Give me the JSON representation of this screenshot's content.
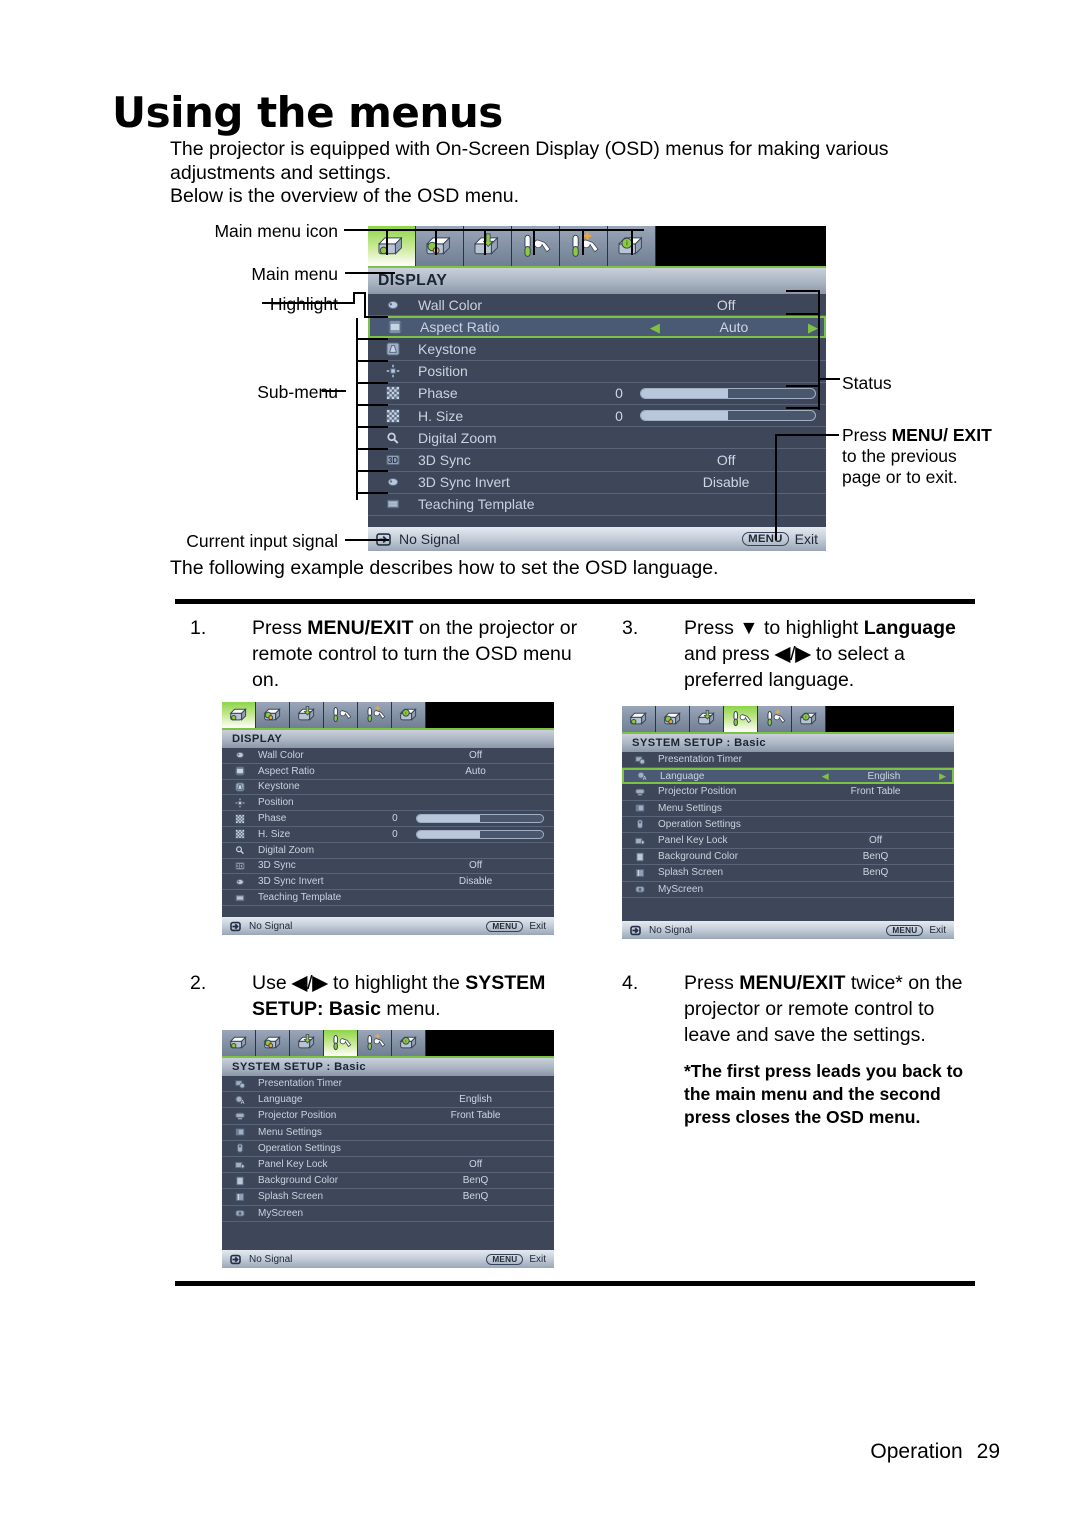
{
  "page": {
    "heading": "Using the menus",
    "intro_p1": "The projector is equipped with On-Screen Display (OSD) menus for making various adjustments and settings.",
    "intro_p2": "Below is the overview of the OSD menu.",
    "example_line": "The following example describes how to set the OSD language.",
    "footer_label": "Operation",
    "footer_page": "29"
  },
  "callouts": {
    "main_menu_icon": "Main menu icon",
    "main_menu": "Main menu",
    "highlight": "Highlight",
    "sub_menu": "Sub-menu",
    "current_input_signal": "Current input signal",
    "status": "Status",
    "press_menu_exit": {
      "pre": "Press ",
      "bold": "MENU/ EXIT",
      "post": " to the previous page or to exit."
    }
  },
  "steps": [
    {
      "num": "1.",
      "parts": [
        {
          "t": "Press ",
          "b": false
        },
        {
          "t": "MENU/EXIT",
          "b": true
        },
        {
          "t": " on the projector or remote control to turn the OSD menu on.",
          "b": false
        }
      ]
    },
    {
      "num": "2.",
      "parts": [
        {
          "t": "Use ",
          "b": false
        },
        {
          "t": "◀",
          "b": true
        },
        {
          "t": "/",
          "b": false
        },
        {
          "t": "▶",
          "b": true
        },
        {
          "t": " to highlight the ",
          "b": false
        },
        {
          "t": "SYSTEM SETUP: Basic",
          "b": true
        },
        {
          "t": " menu.",
          "b": false
        }
      ]
    },
    {
      "num": "3.",
      "parts": [
        {
          "t": "Press ",
          "b": false
        },
        {
          "t": "▼",
          "b": true
        },
        {
          "t": " to highlight ",
          "b": false
        },
        {
          "t": "Language",
          "b": true
        },
        {
          "t": " and press ",
          "b": false
        },
        {
          "t": "◀",
          "b": true
        },
        {
          "t": "/",
          "b": false
        },
        {
          "t": "▶",
          "b": true
        },
        {
          "t": " to select a preferred language.",
          "b": false
        }
      ]
    },
    {
      "num": "4.",
      "parts": [
        {
          "t": "Press ",
          "b": false
        },
        {
          "t": "MENU/EXIT",
          "b": true
        },
        {
          "t": " twice* on the projector or remote control to leave and save the settings.",
          "b": false
        }
      ],
      "note": "*The first press leads you back to the main menu and the second press closes the OSD menu."
    }
  ],
  "osd_colors": {
    "panel_bg": "#3e4759",
    "highlight_green": "#7dc242",
    "row_divider": "#59637a",
    "label_text": "#c9d2e0",
    "title_text": "#1a2433"
  },
  "osd_screens": {
    "display_large": {
      "title": "DISPLAY",
      "selected_tab": 0,
      "tabs": [
        "display-icon",
        "picture-icon",
        "source-icon",
        "system-setup-basic-icon",
        "system-setup-advanced-icon",
        "information-icon"
      ],
      "rows": [
        {
          "icon": "wall-color-icon",
          "label": "Wall Color",
          "value": "Off"
        },
        {
          "icon": "aspect-ratio-icon",
          "label": "Aspect Ratio",
          "value": "Auto",
          "highlight": true,
          "arrows": true
        },
        {
          "icon": "keystone-icon",
          "label": "Keystone",
          "value": ""
        },
        {
          "icon": "position-icon",
          "label": "Position",
          "value": ""
        },
        {
          "icon": "phase-icon",
          "label": "Phase",
          "value": "0",
          "bar": 50
        },
        {
          "icon": "h-size-icon",
          "label": "H. Size",
          "value": "0",
          "bar": 50
        },
        {
          "icon": "digital-zoom-icon",
          "label": "Digital Zoom",
          "value": ""
        },
        {
          "icon": "3d-sync-icon",
          "label": "3D Sync",
          "value": "Off"
        },
        {
          "icon": "3d-sync-invert-icon",
          "label": "3D Sync Invert",
          "value": "Disable"
        },
        {
          "icon": "teaching-template-icon",
          "label": "Teaching Template",
          "value": ""
        }
      ],
      "status_signal": "No Signal",
      "status_key": "MENU",
      "status_action": "Exit"
    },
    "display_small": {
      "title": "DISPLAY",
      "selected_tab": 0,
      "rows": [
        {
          "icon": "wall-color-icon",
          "label": "Wall Color",
          "value": "Off"
        },
        {
          "icon": "aspect-ratio-icon",
          "label": "Aspect Ratio",
          "value": "Auto"
        },
        {
          "icon": "keystone-icon",
          "label": "Keystone",
          "value": ""
        },
        {
          "icon": "position-icon",
          "label": "Position",
          "value": ""
        },
        {
          "icon": "phase-icon",
          "label": "Phase",
          "value": "0",
          "bar": 50
        },
        {
          "icon": "h-size-icon",
          "label": "H. Size",
          "value": "0",
          "bar": 50
        },
        {
          "icon": "digital-zoom-icon",
          "label": "Digital Zoom",
          "value": ""
        },
        {
          "icon": "3d-sync-icon",
          "label": "3D Sync",
          "value": "Off"
        },
        {
          "icon": "3d-sync-invert-icon",
          "label": "3D Sync Invert",
          "value": "Disable"
        },
        {
          "icon": "teaching-template-icon",
          "label": "Teaching Template",
          "value": ""
        }
      ],
      "status_signal": "No Signal",
      "status_key": "MENU",
      "status_action": "Exit"
    },
    "system_setup_plain": {
      "title": "SYSTEM SETUP : Basic",
      "selected_tab": 3,
      "rows": [
        {
          "icon": "presentation-timer-icon",
          "label": "Presentation Timer",
          "value": ""
        },
        {
          "icon": "language-icon",
          "label": "Language",
          "value": "English"
        },
        {
          "icon": "projector-position-icon",
          "label": "Projector Position",
          "value": "Front Table"
        },
        {
          "icon": "menu-settings-icon",
          "label": "Menu Settings",
          "value": ""
        },
        {
          "icon": "operation-settings-icon",
          "label": "Operation Settings",
          "value": ""
        },
        {
          "icon": "panel-key-lock-icon",
          "label": "Panel Key Lock",
          "value": "Off"
        },
        {
          "icon": "background-color-icon",
          "label": "Background Color",
          "value": "BenQ"
        },
        {
          "icon": "splash-screen-icon",
          "label": "Splash Screen",
          "value": "BenQ"
        },
        {
          "icon": "myscreen-icon",
          "label": "MyScreen",
          "value": ""
        }
      ],
      "status_signal": "No Signal",
      "status_key": "MENU",
      "status_action": "Exit"
    },
    "system_setup_language": {
      "title": "SYSTEM SETUP : Basic",
      "selected_tab": 3,
      "rows": [
        {
          "icon": "presentation-timer-icon",
          "label": "Presentation Timer",
          "value": ""
        },
        {
          "icon": "language-icon",
          "label": "Language",
          "value": "English",
          "highlight": true,
          "arrows": true
        },
        {
          "icon": "projector-position-icon",
          "label": "Projector Position",
          "value": "Front Table"
        },
        {
          "icon": "menu-settings-icon",
          "label": "Menu Settings",
          "value": ""
        },
        {
          "icon": "operation-settings-icon",
          "label": "Operation Settings",
          "value": ""
        },
        {
          "icon": "panel-key-lock-icon",
          "label": "Panel Key Lock",
          "value": "Off"
        },
        {
          "icon": "background-color-icon",
          "label": "Background Color",
          "value": "BenQ"
        },
        {
          "icon": "splash-screen-icon",
          "label": "Splash Screen",
          "value": "BenQ"
        },
        {
          "icon": "myscreen-icon",
          "label": "MyScreen",
          "value": ""
        }
      ],
      "status_signal": "No Signal",
      "status_key": "MENU",
      "status_action": "Exit"
    }
  }
}
